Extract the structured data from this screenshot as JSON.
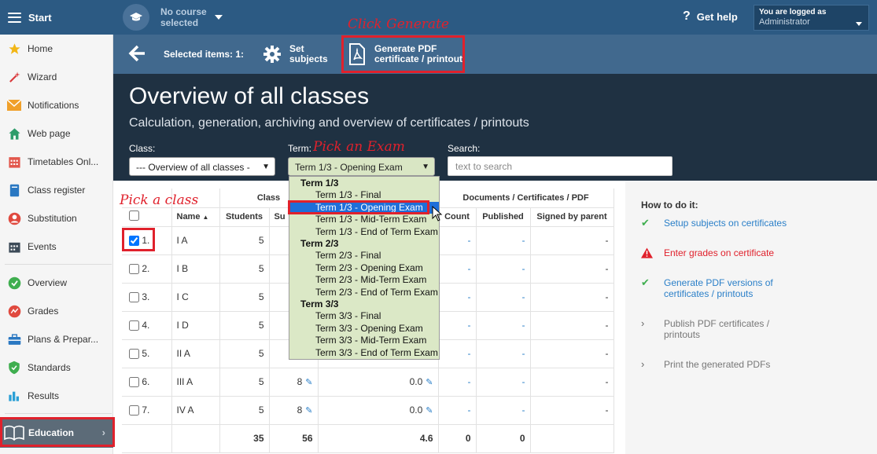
{
  "topbar": {
    "start_label": "Start",
    "course_line1": "No course",
    "course_line2": "selected",
    "help_label": "Get help",
    "logged_label": "You are logged as",
    "logged_user": "Administrator"
  },
  "sidebar": {
    "items": [
      {
        "label": "Home",
        "icon": "star-icon"
      },
      {
        "label": "Wizard",
        "icon": "wand-icon"
      },
      {
        "label": "Notifications",
        "icon": "envelope-icon"
      },
      {
        "label": "Web page",
        "icon": "house-icon"
      },
      {
        "label": "Timetables Onl...",
        "icon": "calendar-grid-icon"
      },
      {
        "label": "Class register",
        "icon": "book-icon"
      },
      {
        "label": "Substitution",
        "icon": "person-icon"
      },
      {
        "label": "Events",
        "icon": "calendar-icon"
      },
      {
        "label": "Overview",
        "icon": "check-circle-icon"
      },
      {
        "label": "Grades",
        "icon": "grades-icon"
      },
      {
        "label": "Plans & Prepar...",
        "icon": "briefcase-icon"
      },
      {
        "label": "Standards",
        "icon": "shield-check-icon"
      },
      {
        "label": "Results",
        "icon": "bar-chart-icon"
      }
    ],
    "education_label": "Education"
  },
  "toolbar": {
    "selected_label": "Selected items: 1:",
    "set_subjects_line1": "Set",
    "set_subjects_line2": "subjects",
    "generate_line1": "Generate PDF",
    "generate_line2": "certificate / printout"
  },
  "header": {
    "title": "Overview of all classes",
    "subtitle": "Calculation, generation, archiving and overview of certificates / printouts",
    "class_label": "Class:",
    "class_value": "--- Overview of all classes -",
    "term_label": "Term:",
    "term_value": "Term 1/3 - Opening Exam",
    "search_label": "Search:",
    "search_placeholder": "text to search"
  },
  "dropdown": {
    "groups": [
      {
        "label": "Term 1/3",
        "options": [
          "Term 1/3 - Final",
          "Term 1/3 - Opening Exam",
          "Term 1/3 - Mid-Term Exam",
          "Term 1/3 - End of Term Exam"
        ]
      },
      {
        "label": "Term 2/3",
        "options": [
          "Term 2/3 - Final",
          "Term 2/3 - Opening Exam",
          "Term 2/3 - Mid-Term Exam",
          "Term 2/3 - End of Term Exam"
        ]
      },
      {
        "label": "Term 3/3",
        "options": [
          "Term 3/3 - Final",
          "Term 3/3 - Opening Exam",
          "Term 3/3 - Mid-Term Exam",
          "Term 3/3 - End of Term Exam"
        ]
      }
    ],
    "selected": "Term 1/3 - Opening Exam"
  },
  "table": {
    "group_class": "Class",
    "group_docs": "Documents / Certificates / PDF",
    "col_name": "Name",
    "col_students": "Students",
    "col_subjects": "Su",
    "col_count": "Count",
    "col_published": "Published",
    "col_signed": "Signed by parent",
    "rows": [
      {
        "idx": "1.",
        "name": "I A",
        "students": "5",
        "subjects": "",
        "avg": "",
        "count": "-",
        "published": "-",
        "signed": "-",
        "checked": true
      },
      {
        "idx": "2.",
        "name": "I B",
        "students": "5",
        "subjects": "",
        "avg": "",
        "count": "-",
        "published": "-",
        "signed": "-",
        "checked": false
      },
      {
        "idx": "3.",
        "name": "I C",
        "students": "5",
        "subjects": "",
        "avg": "",
        "count": "-",
        "published": "-",
        "signed": "-",
        "checked": false
      },
      {
        "idx": "4.",
        "name": "I D",
        "students": "5",
        "subjects": "",
        "avg": "",
        "count": "-",
        "published": "-",
        "signed": "-",
        "checked": false
      },
      {
        "idx": "5.",
        "name": "II A",
        "students": "5",
        "subjects": "",
        "avg": "",
        "count": "-",
        "published": "-",
        "signed": "-",
        "checked": false
      },
      {
        "idx": "6.",
        "name": "III A",
        "students": "5",
        "subjects": "8",
        "avg": "0.0",
        "count": "-",
        "published": "-",
        "signed": "-",
        "checked": false
      },
      {
        "idx": "7.",
        "name": "IV A",
        "students": "5",
        "subjects": "8",
        "avg": "0.0",
        "count": "-",
        "published": "-",
        "signed": "-",
        "checked": false
      }
    ],
    "totals": {
      "students": "35",
      "subjects": "56",
      "avg": "4.6",
      "count": "0",
      "published": "0"
    }
  },
  "howto": {
    "title": "How to do it:",
    "steps": [
      {
        "text": "Setup subjects on certificates",
        "status": "done"
      },
      {
        "text": "Enter grades on certificate",
        "status": "warning"
      },
      {
        "text": "Generate PDF versions of certificates / printouts",
        "status": "done"
      },
      {
        "text": "Publish PDF certificates / printouts",
        "status": "todo"
      },
      {
        "text": "Print the generated PDFs",
        "status": "todo"
      }
    ]
  },
  "annotations": {
    "click_generate": "Click Generate",
    "pick_exam": "Pick an Exam",
    "pick_class": "Pick a class"
  },
  "colors": {
    "accent_red": "#e0212c",
    "link_blue": "#2a7fc8",
    "topbar": "#2c5a83",
    "header_dark": "#1f3142"
  }
}
